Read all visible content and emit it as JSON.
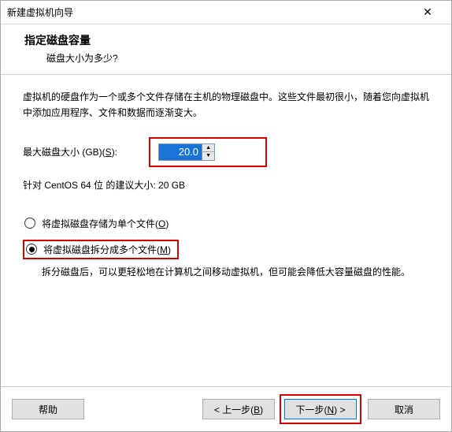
{
  "titlebar": {
    "title": "新建虚拟机向导",
    "close": "✕"
  },
  "header": {
    "heading": "指定磁盘容量",
    "sub": "磁盘大小为多少?"
  },
  "content": {
    "description": "虚拟机的硬盘作为一个或多个文件存储在主机的物理磁盘中。这些文件最初很小，随着您向虚拟机中添加应用程序、文件和数据而逐渐变大。",
    "size_label_pre": "最大磁盘大小 (GB)(",
    "size_label_key": "S",
    "size_label_post": "):",
    "size_value": "20.0",
    "recommended": "针对 CentOS 64 位 的建议大小: 20 GB",
    "radio_single_pre": "将虚拟磁盘存储为单个文件(",
    "radio_single_key": "O",
    "radio_single_post": ")",
    "radio_split_pre": "将虚拟磁盘拆分成多个文件(",
    "radio_split_key": "M",
    "radio_split_post": ")",
    "split_desc": "拆分磁盘后，可以更轻松地在计算机之间移动虚拟机，但可能会降低大容量磁盘的性能。"
  },
  "footer": {
    "help": "帮助",
    "back_pre": "< 上一步(",
    "back_key": "B",
    "back_post": ")",
    "next_pre": "下一步(",
    "next_key": "N",
    "next_post": ") >",
    "cancel": "取消"
  }
}
